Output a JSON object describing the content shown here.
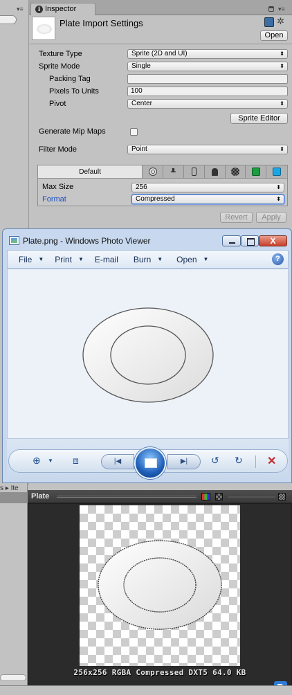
{
  "inspector": {
    "tab_label": "Inspector",
    "title": "Plate Import Settings",
    "open_label": "Open",
    "properties": [
      {
        "label": "Texture Type",
        "value": "Sprite (2D and UI)"
      },
      {
        "label": "Sprite Mode",
        "value": "Single"
      },
      {
        "label": "Packing Tag",
        "value": ""
      },
      {
        "label": "Pixels To Units",
        "value": "100"
      },
      {
        "label": "Pivot",
        "value": "Center"
      }
    ],
    "sprite_editor_label": "Sprite Editor",
    "mipmaps_label": "Generate Mip Maps",
    "mipmaps_checked": false,
    "filter_label": "Filter Mode",
    "filter_value": "Point",
    "platform": {
      "default_tab": "Default",
      "icons": [
        "web-icon",
        "download-icon",
        "mobile-icon",
        "android-icon",
        "blackberry-icon",
        "windows-store-icon",
        "windows-phone-icon"
      ],
      "max_size_label": "Max Size",
      "max_size_value": "256",
      "format_label": "Format",
      "format_value": "Compressed"
    },
    "revert_label": "Revert",
    "apply_label": "Apply"
  },
  "photo_viewer": {
    "title": "Plate.png - Windows Photo Viewer",
    "close_glyph": "X",
    "menu": [
      {
        "label": "File",
        "has_caret": true
      },
      {
        "label": "Print",
        "has_caret": true
      },
      {
        "label": "E-mail",
        "has_caret": false
      },
      {
        "label": "Burn",
        "has_caret": true
      },
      {
        "label": "Open",
        "has_caret": true
      }
    ],
    "help_glyph": "?"
  },
  "lower_left": {
    "breadcrumb": "s ▸ Ite"
  },
  "preview": {
    "title": "Plate",
    "info": "256x256  RGBA Compressed DXT5   64.0 KB"
  },
  "colors": {
    "format_label": "#1c4fbf",
    "close_button": "#c7412b",
    "tag_icon": "#2d7bd8"
  }
}
